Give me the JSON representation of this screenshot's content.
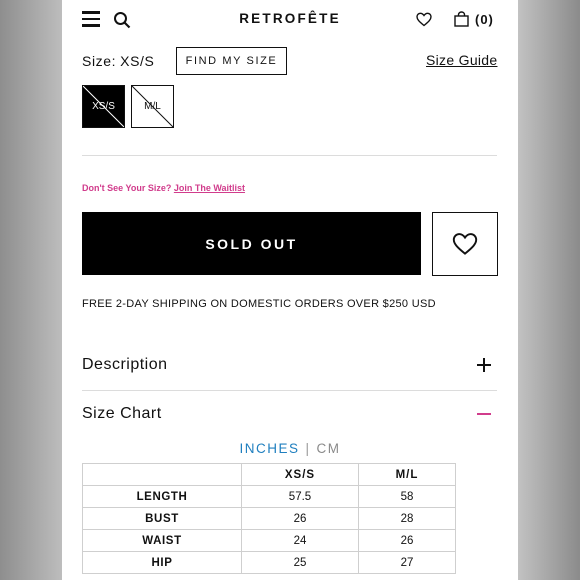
{
  "header": {
    "brand": "RETROFÊTE",
    "cart_count": "(0)"
  },
  "size": {
    "label": "Size:",
    "selected": "XS/S",
    "find_my_size_label": "FIND MY SIZE",
    "size_guide_label": "Size Guide",
    "options": [
      "XS/S",
      "M/L"
    ]
  },
  "waitlist": {
    "prompt": "Don't See Your Size?",
    "link": "Join The Waitlist"
  },
  "actions": {
    "sold_out_label": "SOLD OUT"
  },
  "shipping_note": "FREE 2-DAY SHIPPING ON DOMESTIC ORDERS OVER $250 USD",
  "accordion": {
    "description_title": "Description",
    "size_chart_title": "Size Chart"
  },
  "units": {
    "active": "INCHES",
    "separator": "|",
    "inactive": "CM"
  },
  "size_chart": {
    "columns": [
      "",
      "XS/S",
      "M/L"
    ],
    "rows": [
      {
        "label": "LENGTH",
        "values": [
          "57.5",
          "58"
        ]
      },
      {
        "label": "BUST",
        "values": [
          "26",
          "28"
        ]
      },
      {
        "label": "WAIST",
        "values": [
          "24",
          "26"
        ]
      },
      {
        "label": "HIP",
        "values": [
          "25",
          "27"
        ]
      }
    ]
  },
  "colors": {
    "accent_pink": "#d13c8c",
    "accent_blue": "#1f7fbf",
    "primary": "#000000"
  },
  "icons": [
    "menu-icon",
    "search-icon",
    "heart-icon",
    "bag-icon",
    "plus-icon",
    "minus-icon"
  ]
}
